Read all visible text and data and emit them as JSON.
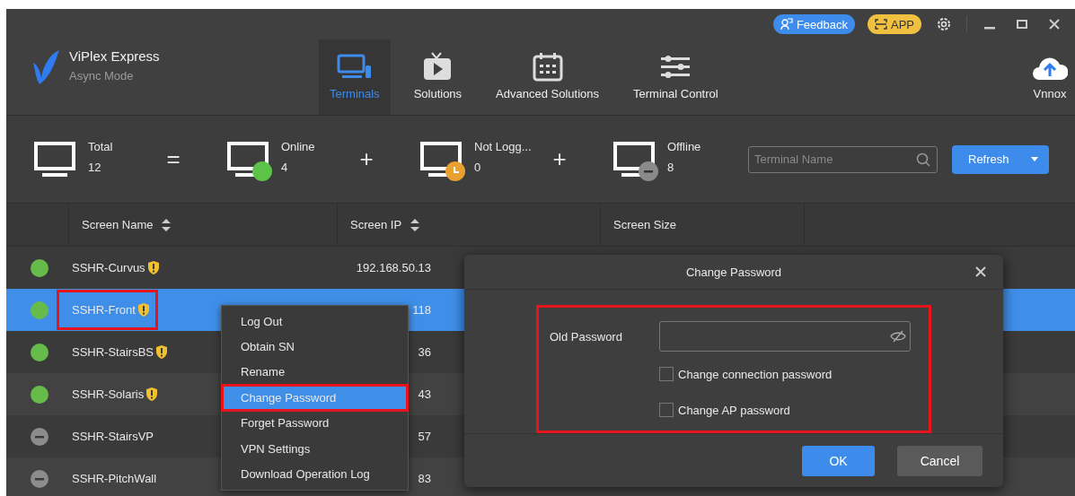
{
  "app": {
    "name": "ViPlex Express",
    "mode": "Async Mode"
  },
  "title_bar": {
    "feedback": "Feedback",
    "app": "APP"
  },
  "nav": [
    {
      "label": "Terminals",
      "selected": true
    },
    {
      "label": "Solutions",
      "selected": false
    },
    {
      "label": "Advanced Solutions",
      "selected": false
    },
    {
      "label": "Terminal Control",
      "selected": false
    }
  ],
  "vnnox": {
    "label": "Vnnox"
  },
  "stats": [
    {
      "kind": "total",
      "label": "Total",
      "count": "12",
      "operator": "="
    },
    {
      "kind": "online",
      "label": "Online",
      "count": "4",
      "operator": "+"
    },
    {
      "kind": "pending",
      "label": "Not Logg...",
      "count": "0",
      "operator": "+"
    },
    {
      "kind": "offline",
      "label": "Offline",
      "count": "8"
    }
  ],
  "search": {
    "placeholder": "Terminal Name"
  },
  "refresh": {
    "label": "Refresh"
  },
  "table": {
    "columns": [
      {
        "label": "Screen Name",
        "sortable": true
      },
      {
        "label": "Screen IP",
        "sortable": true
      },
      {
        "label": "Screen Size",
        "sortable": false
      }
    ],
    "rows": [
      {
        "kind": "online",
        "name": "SSHR-Curvus",
        "warning": true,
        "ip": "192.168.50.13",
        "selected": false,
        "annotated": false
      },
      {
        "kind": "online",
        "name": "SSHR-Front",
        "warning": true,
        "ip": "118",
        "selected": true,
        "annotated": true
      },
      {
        "kind": "online",
        "name": "SSHR-StairsBS",
        "warning": true,
        "ip": "36",
        "selected": false,
        "annotated": false
      },
      {
        "kind": "online",
        "name": "SSHR-Solaris",
        "warning": true,
        "ip": "43",
        "selected": false,
        "annotated": false
      },
      {
        "kind": "offline",
        "name": "SSHR-StairsVP",
        "warning": false,
        "ip": "57",
        "selected": false,
        "annotated": false
      },
      {
        "kind": "offline",
        "name": "SSHR-PitchWall",
        "warning": false,
        "ip": "83",
        "selected": false,
        "annotated": false
      }
    ]
  },
  "context_menu": [
    {
      "label": "Log Out",
      "selected": false
    },
    {
      "label": "Obtain SN",
      "selected": false
    },
    {
      "label": "Rename",
      "selected": false
    },
    {
      "label": "Change Password",
      "selected": true
    },
    {
      "label": "Forget Password",
      "selected": false
    },
    {
      "label": "VPN Settings",
      "selected": false
    },
    {
      "label": "Download Operation Log",
      "selected": false
    }
  ],
  "dialog": {
    "title": "Change Password",
    "annotated": true,
    "field_label": "Old Password",
    "checkboxes": [
      {
        "label": "Change connection password",
        "checked": false
      },
      {
        "label": "Change AP password",
        "checked": false
      }
    ],
    "buttons": [
      {
        "kind": "primary",
        "label": "OK"
      },
      {
        "kind": "secondary",
        "label": "Cancel"
      }
    ]
  }
}
